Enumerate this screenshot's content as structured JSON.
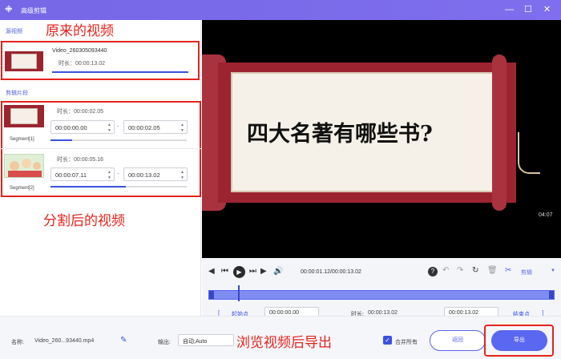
{
  "window": {
    "title": "高级剪辑",
    "logo": "ꔰ",
    "minimize": "—",
    "maximize": "☐",
    "close": "✕"
  },
  "left": {
    "source_label": "源视频",
    "source": {
      "name": "Video_260305093440",
      "duration": "时长：00:00:13.02",
      "progress": 1.0
    },
    "clips_label": "剪辑片段",
    "segments": [
      {
        "duration": "时长：00:00:02.05",
        "start": "00:00:00.00",
        "end": "00:00:02.05",
        "label": "Segment[1]",
        "progress": 0.16
      },
      {
        "duration": "时长：00:00:05.16",
        "start": "00:00:07.11",
        "end": "00:00:13.02",
        "label": "Segment[2]",
        "progress": 0.55
      }
    ]
  },
  "annotations": {
    "original": "原来的视频",
    "split": "分割后的视频",
    "export": "浏览视频后导出"
  },
  "preview": {
    "text": "四大名著有哪些书?",
    "timestamp": "04:07"
  },
  "playback": {
    "time": "00:00:01.12/00:00:13.02",
    "cut_label": "剪辑",
    "playhead": 0.086
  },
  "range": {
    "start_btn": "起始点",
    "start_val": "00:00:00.00",
    "dur_label": "时长:",
    "dur_val": "00:00:13.02",
    "end_val": "00:00:13.02",
    "end_btn": "结束点",
    "lbracket": "[",
    "rbracket": "]"
  },
  "bottom": {
    "name_label": "名称:",
    "name_value": "Video_260...93440.mp4",
    "output_label": "输出:",
    "output_value": "自动;Auto",
    "merge_label": "合并所有",
    "back": "返回",
    "export": "导出"
  },
  "colors": {
    "accent": "#5a67f0",
    "red": "#e3241c",
    "scroll": "#9c2431"
  }
}
